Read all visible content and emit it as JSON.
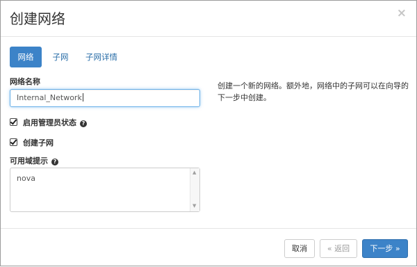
{
  "modal": {
    "title": "创建网络",
    "close_glyph": "×"
  },
  "tabs": [
    {
      "label": "网络",
      "active": true
    },
    {
      "label": "子网",
      "active": false
    },
    {
      "label": "子网详情",
      "active": false
    }
  ],
  "form": {
    "network_name_label": "网络名称",
    "network_name_value": "Internal_Network",
    "admin_state_label": "启用管理员状态",
    "admin_state_checked": true,
    "create_subnet_label": "创建子网",
    "create_subnet_checked": true,
    "az_hints_label": "可用域提示",
    "az_hints_value": "nova"
  },
  "help_text": "创建一个新的网络。额外地，网络中的子网可以在向导的下一步中创建。",
  "icons": {
    "help": "question-circle-icon",
    "checkbox": "check-square-icon"
  },
  "footer": {
    "cancel_label": "取消",
    "back_label": "« 返回",
    "next_label": "下一步 »"
  },
  "colors": {
    "primary": "#3c83c8",
    "link": "#2a6ea8",
    "focus_border": "#66afe9"
  }
}
